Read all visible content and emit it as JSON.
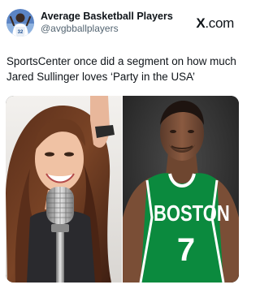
{
  "account": {
    "display_name": "Average Basketball Players",
    "handle": "@avgbballplayers",
    "avatar_icon": "basketball-player-avatar"
  },
  "brand": {
    "name": "X",
    "suffix": ".com"
  },
  "post": {
    "text": "SportsCenter once did a segment on how much Jared Sullinger loves ‘Party in the USA’"
  },
  "media": {
    "left_image_icon": "singer-with-microphone-photo",
    "right_image_icon": "celtics-player-photo",
    "jersey_team": "BOSTON",
    "jersey_number": "7"
  },
  "colors": {
    "text_primary": "#0f1419",
    "text_secondary": "#536471",
    "celtics_green": "#0b8a3e"
  }
}
